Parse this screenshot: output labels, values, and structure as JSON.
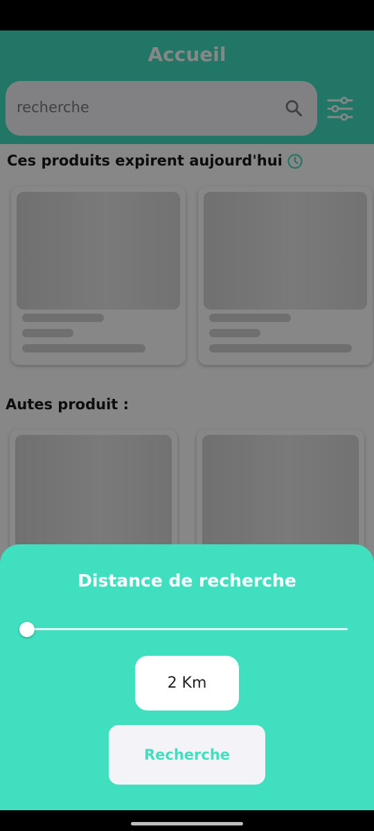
{
  "header": {
    "title": "Accueil"
  },
  "search": {
    "placeholder": "recherche",
    "icon": "search-icon",
    "filter_icon": "sliders-icon"
  },
  "sections": {
    "expiring_title": "Ces produits expirent aujourd'hui",
    "expiring_icon": "clock-icon",
    "others_title": "Autes produit :"
  },
  "distance_sheet": {
    "title": "Distance de recherche",
    "slider_value_fraction": 0.0,
    "distance_label": "2 Km",
    "search_button_label": "Recherche"
  },
  "colors": {
    "accent": "#3fdfc0",
    "surface": "#f4f4f8"
  }
}
